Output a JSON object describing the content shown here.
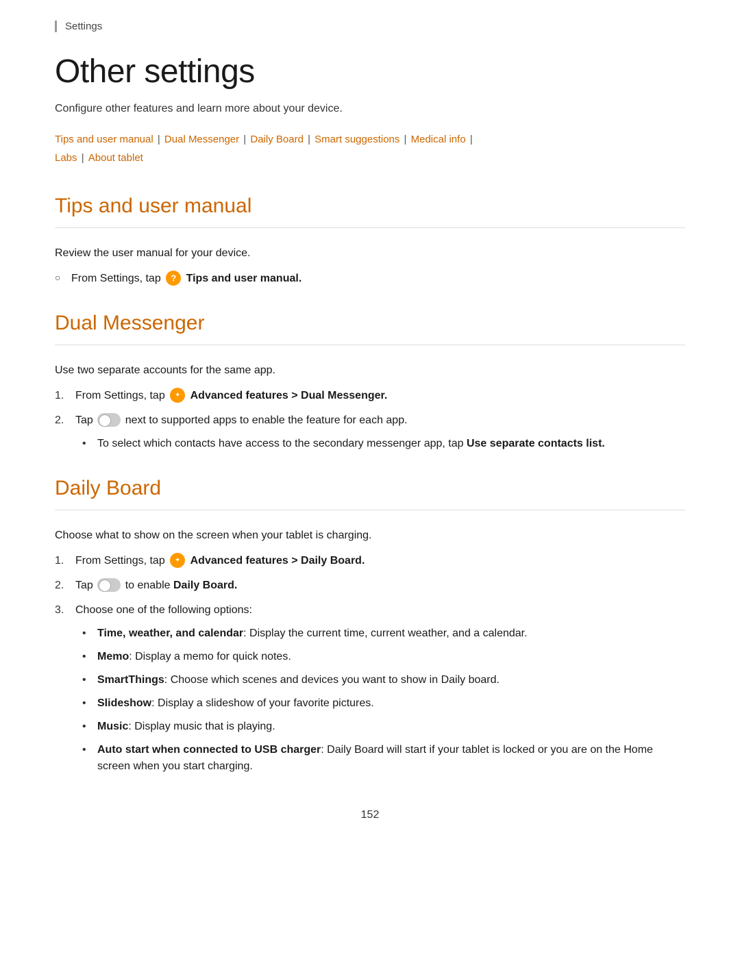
{
  "breadcrumb": "Settings",
  "page": {
    "title": "Other settings",
    "subtitle": "Configure other features and learn more about your device.",
    "nav_links": [
      "Tips and user manual",
      "Dual Messenger",
      "Daily Board",
      "Smart suggestions",
      "Medical info",
      "Labs",
      "About tablet"
    ]
  },
  "sections": {
    "tips": {
      "title": "Tips and user manual",
      "description": "Review the user manual for your device.",
      "steps": [
        {
          "text_pre": "From Settings, tap",
          "icon": "tips",
          "text_bold": "Tips and user manual.",
          "text_post": ""
        }
      ]
    },
    "dual_messenger": {
      "title": "Dual Messenger",
      "description": "Use two separate accounts for the same app.",
      "steps": [
        {
          "text_pre": "From Settings, tap",
          "icon": "advanced",
          "text_bold": "Advanced features > Dual Messenger.",
          "text_post": ""
        },
        {
          "text_pre": "Tap",
          "icon": "toggle",
          "text_post": "next to supported apps to enable the feature for each app.",
          "sub_bullets": [
            {
              "text_pre": "To select which contacts have access to the secondary messenger app, tap ",
              "text_bold": "Use separate contacts list.",
              "text_post": ""
            }
          ]
        }
      ]
    },
    "daily_board": {
      "title": "Daily Board",
      "description": "Choose what to show on the screen when your tablet is charging.",
      "steps": [
        {
          "text_pre": "From Settings, tap",
          "icon": "advanced",
          "text_bold": "Advanced features > Daily Board.",
          "text_post": ""
        },
        {
          "text_pre": "Tap",
          "icon": "toggle",
          "text_post": "to enable",
          "text_bold_end": "Daily Board.",
          "text_post2": ""
        },
        {
          "text_pre": "Choose one of the following options:",
          "sub_bullets": [
            {
              "text_bold": "Time, weather, and calendar",
              "text_post": ": Display the current time, current weather, and a calendar."
            },
            {
              "text_bold": "Memo",
              "text_post": ": Display a memo for quick notes."
            },
            {
              "text_bold": "SmartThings",
              "text_post": ": Choose which scenes and devices you want to show in Daily board."
            },
            {
              "text_bold": "Slideshow",
              "text_post": ": Display a slideshow of your favorite pictures."
            },
            {
              "text_bold": "Music",
              "text_post": ": Display music that is playing."
            },
            {
              "text_bold": "Auto start when connected to USB charger",
              "text_post": ": Daily Board will start if your tablet is locked or you are on the Home screen when you start charging."
            }
          ]
        }
      ]
    }
  },
  "page_number": "152"
}
